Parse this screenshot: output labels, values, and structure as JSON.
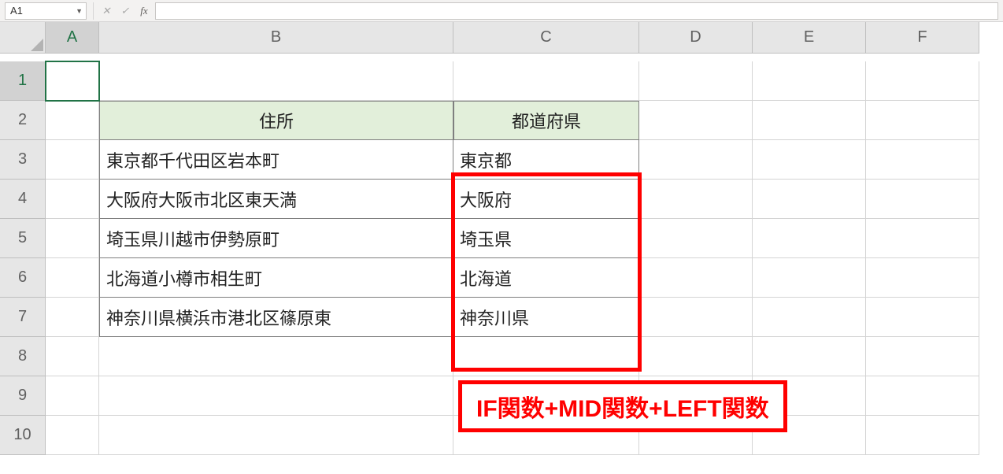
{
  "formula_bar": {
    "name_box": "A1",
    "cancel": "✕",
    "enter": "✓",
    "fx": "fx",
    "formula": ""
  },
  "columns": [
    "A",
    "B",
    "C",
    "D",
    "E",
    "F"
  ],
  "row_numbers": [
    "1",
    "2",
    "3",
    "4",
    "5",
    "6",
    "7",
    "8",
    "9",
    "10"
  ],
  "headers": {
    "b2": "住所",
    "c2": "都道府県"
  },
  "data": [
    {
      "b": "東京都千代田区岩本町",
      "c": "東京都"
    },
    {
      "b": "大阪府大阪市北区東天満",
      "c": "大阪府"
    },
    {
      "b": "埼玉県川越市伊勢原町",
      "c": "埼玉県"
    },
    {
      "b": "北海道小樽市相生町",
      "c": "北海道"
    },
    {
      "b": "神奈川県横浜市港北区篠原東",
      "c": "神奈川県"
    }
  ],
  "annotation": "IF関数+MID関数+LEFT関数"
}
